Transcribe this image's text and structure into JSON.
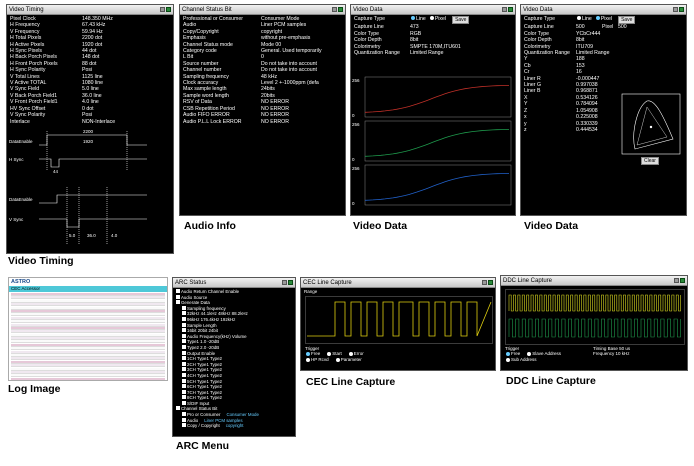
{
  "captions": {
    "video_timing": "Video Timing",
    "audio_info": "Audio Info",
    "video_data_1": "Video Data",
    "video_data_2": "Video Data",
    "log_image": "Log Image",
    "arc_menu": "ARC Menu",
    "cec_line": "CEC Line Capture",
    "ddc_line": "DDC Line Capture"
  },
  "timing": {
    "title": "Video Timing",
    "rows": [
      [
        "Pixel Clock",
        "148.350 MHz"
      ],
      [
        "H Frequency",
        "67.43 kHz"
      ],
      [
        "V Frequency",
        "59.94 Hz"
      ],
      [
        "H Total Pixels",
        "2200 dot"
      ],
      [
        "H Active Pixels",
        "1920 dot"
      ],
      [
        "H Sync Pixels",
        "44 dot"
      ],
      [
        "H Back Porch Pixels",
        "148 dot"
      ],
      [
        "H Front Porch Pixels",
        "88 dot"
      ],
      [
        "H Sync Polarity",
        "Posi"
      ],
      [
        "V Total Lines",
        "1125 line"
      ],
      [
        "V Active TOTAL",
        "1080 line"
      ],
      [
        "V Sync Field",
        "5.0 line"
      ],
      [
        "V Back Porch Field1",
        "36.0 line"
      ],
      [
        "V Front Porch Field1",
        "4.0 line"
      ],
      [
        "HV Sync Offset",
        "0 dot"
      ],
      [
        "V Sync Polarity",
        "Posi"
      ],
      [
        "Interlace",
        "NON-Interlace"
      ]
    ],
    "diagram_labels": {
      "dataenable": "DataEnable",
      "hsync": "H Sync",
      "total": "2200",
      "active": "1920",
      "d44": "44",
      "dataenable2": "DataEnable",
      "vsync": "V Sync",
      "v5": "5.0",
      "v36": "36.0",
      "v4": "4.0"
    }
  },
  "audio": {
    "title": "Channel Status Bit",
    "rows": [
      [
        "Professional or Consumer",
        "Consumer Mode"
      ],
      [
        "Audio",
        "Liner PCM samples"
      ],
      [
        "Copy/Copyright",
        "copyright"
      ],
      [
        "Emphasis",
        "without pre-emphasis"
      ],
      [
        "Channel Status mode",
        "Mode 00"
      ],
      [
        "Category code",
        "General. Used temporarily"
      ],
      [
        "L Bit",
        "0"
      ],
      [
        "Source number",
        "Do not take into account"
      ],
      [
        "Channel number",
        "Do not take into account"
      ],
      [
        "Sampling frequency",
        "48 kHz"
      ],
      [
        "Clock accuracy",
        "Level 2 +-1000ppm (defa"
      ],
      [
        "Max sample length",
        "24bits"
      ],
      [
        "Sample word length",
        "20bits"
      ],
      [
        "RSV of Data",
        "NO ERROR"
      ],
      [
        "CSB Repetition Period",
        "NO ERROR"
      ],
      [
        "Audio FIFO ERROR",
        "NO ERROR"
      ],
      [
        "Audio P.L.L Lock ERROR",
        "NO ERROR"
      ]
    ]
  },
  "vd1": {
    "title": "Video Data",
    "capture_type_label": "Capture Type",
    "opt_line": "Line",
    "opt_pixel": "Pixel",
    "save": "Save",
    "rows": [
      [
        "Capture Line",
        "473"
      ],
      [
        "Color Type",
        "RGB"
      ],
      [
        "Color Depth",
        "8bit"
      ],
      [
        "Colorimetry",
        "SMPTE 170M,ITU601"
      ],
      [
        "Quantization Range",
        "Limited Range"
      ]
    ],
    "ticks": [
      "256",
      "0",
      "256",
      "0",
      "256",
      "0"
    ]
  },
  "vd2": {
    "title": "Video Data",
    "capture_type_label": "Capture Type",
    "opt_line": "Line",
    "opt_pixel": "Pixel",
    "save": "Save",
    "capture_line_label": "Capture Line",
    "capture_line": "500",
    "pixel_label": "Pixel",
    "pixel": "500",
    "rows": [
      [
        "Color Type",
        "YCbCr444"
      ],
      [
        "Color Depth",
        "8bit"
      ],
      [
        "Colorimetry",
        "ITU709"
      ],
      [
        "Quantization Range",
        "Limited Range"
      ],
      [
        "Y",
        "188"
      ],
      [
        "Cb",
        "153"
      ],
      [
        "Cr",
        "16"
      ],
      [
        "Liner R",
        "-0.000447"
      ],
      [
        "Liner G",
        "0.997038"
      ],
      [
        "Liner B",
        "0.968871"
      ],
      [
        "X",
        "0.534126"
      ],
      [
        "Y",
        "0.784094"
      ],
      [
        "Z",
        "1.054908"
      ],
      [
        "x",
        "0.225008"
      ],
      [
        "y",
        "0.330339"
      ],
      [
        "z",
        "0.444534"
      ]
    ],
    "clear": "Clear"
  },
  "log": {
    "brand": "ASTRO",
    "title": "CEC Accessor"
  },
  "arc": {
    "title": "ARC Status",
    "lines": [
      "Audio Return Channel Enable",
      "Audio Source",
      "Generate Data",
      "Sampling frequency",
      "32kHz   44.1kHz   48kHz   88.2kHz",
      "96kHz   176.4kHz   192kHz",
      "Sample Length",
      "16bit   20bit   24bit",
      "Audio   Frequency(kHz)   Volume",
      "Type1    1.0           -20dB",
      "Type2    2.0           -20dB",
      "Output Enable",
      "1CH  Type1  Type2",
      "2CH  Type1  Type2",
      "3CH  Type1  Type2",
      "4CH  Type1  Type2",
      "5CH  Type1  Type2",
      "6CH  Type1  Type2",
      "7CH  Type1  Type2",
      "8CH  Type1  Type2",
      "S/DIF Input",
      "Channel Status Bit",
      "Pro or Consumer",
      "Audio",
      "Copy / Copyright"
    ],
    "values": [
      "Consumer Mode",
      "Liner PCM samples",
      "copyright"
    ]
  },
  "cec": {
    "title": "CEC Line Capture",
    "range_label": "Range",
    "trigger_label": "Trigger",
    "options": [
      "Free",
      "Start",
      "Error",
      "HP Rcvd",
      "Parameter"
    ]
  },
  "ddc": {
    "title": "DDC Line Capture",
    "trigger_label": "Trigger",
    "options": [
      "Free",
      "Slave Address",
      "Sub Address"
    ],
    "timing_label": "Timing  Base  50 us",
    "freq_label": "Frequency  10 kHz"
  },
  "colors": {
    "red": "#c03028",
    "green": "#1e9a4c",
    "blue": "#2060c8",
    "yellow": "#e0d010",
    "accent": "#3a9bd8"
  }
}
